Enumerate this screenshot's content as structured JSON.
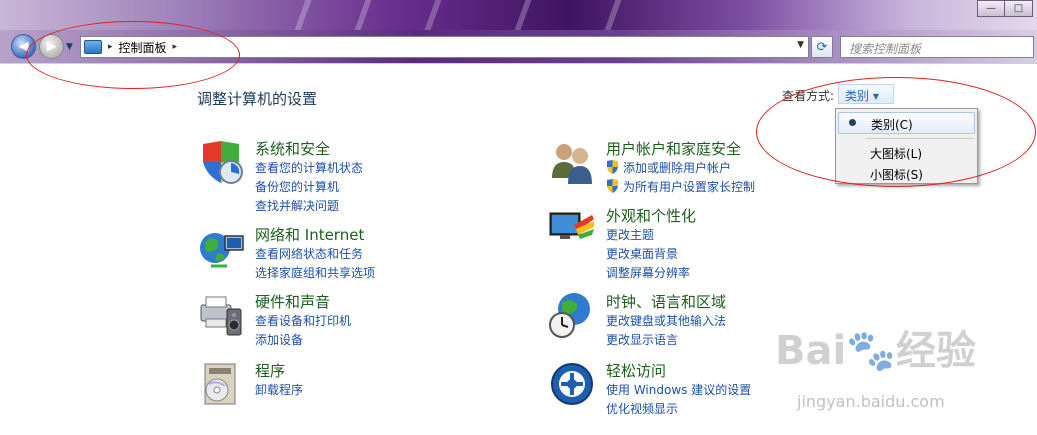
{
  "window": {
    "minimize_label": "—",
    "maximize_label": "□"
  },
  "nav": {
    "back_glyph": "◀",
    "forward_glyph": "▶",
    "dropdown_glyph": "▼"
  },
  "address": {
    "separator": "▸",
    "breadcrumb": "控制面板",
    "trailing_separator": "▸",
    "dropdown_glyph": "▼"
  },
  "refresh_glyph": "⟳",
  "search": {
    "placeholder": "搜索控制面板"
  },
  "header": {
    "title": "调整计算机的设置",
    "view_by_label": "查看方式:",
    "view_by_value": "类别 ▾"
  },
  "categories": [
    {
      "title": "系统和安全",
      "icon": "system-security-icon",
      "links": [
        "查看您的计算机状态",
        "备份您的计算机",
        "查找并解决问题"
      ]
    },
    {
      "title": "网络和 Internet",
      "icon": "network-internet-icon",
      "links": [
        "查看网络状态和任务",
        "选择家庭组和共享选项"
      ]
    },
    {
      "title": "硬件和声音",
      "icon": "hardware-sound-icon",
      "links": [
        "查看设备和打印机",
        "添加设备"
      ]
    },
    {
      "title": "程序",
      "icon": "programs-icon",
      "links": [
        "卸载程序"
      ]
    },
    {
      "title": "用户帐户和家庭安全",
      "icon": "user-accounts-icon",
      "links": [
        "添加或删除用户帐户",
        "为所有用户设置家长控制"
      ]
    },
    {
      "title": "外观和个性化",
      "icon": "appearance-icon",
      "links": [
        "更改主题",
        "更改桌面背景",
        "调整屏幕分辨率"
      ]
    },
    {
      "title": "时钟、语言和区域",
      "icon": "clock-language-icon",
      "links": [
        "更改键盘或其他输入法",
        "更改显示语言"
      ]
    },
    {
      "title": "轻松访问",
      "icon": "ease-of-access-icon",
      "links": [
        "使用 Windows 建议的设置",
        "优化视频显示"
      ]
    }
  ],
  "view_menu": {
    "items": [
      "类别(C)",
      "大图标(L)",
      "小图标(S)"
    ],
    "selected": "类别(C)"
  },
  "colors": {
    "link": "#1e4fa8",
    "category_title": "#1c5f1c",
    "annotation": "#e02020"
  },
  "watermark": {
    "main": "Bai🐾经验",
    "sub": "jingyan.baidu.com"
  }
}
